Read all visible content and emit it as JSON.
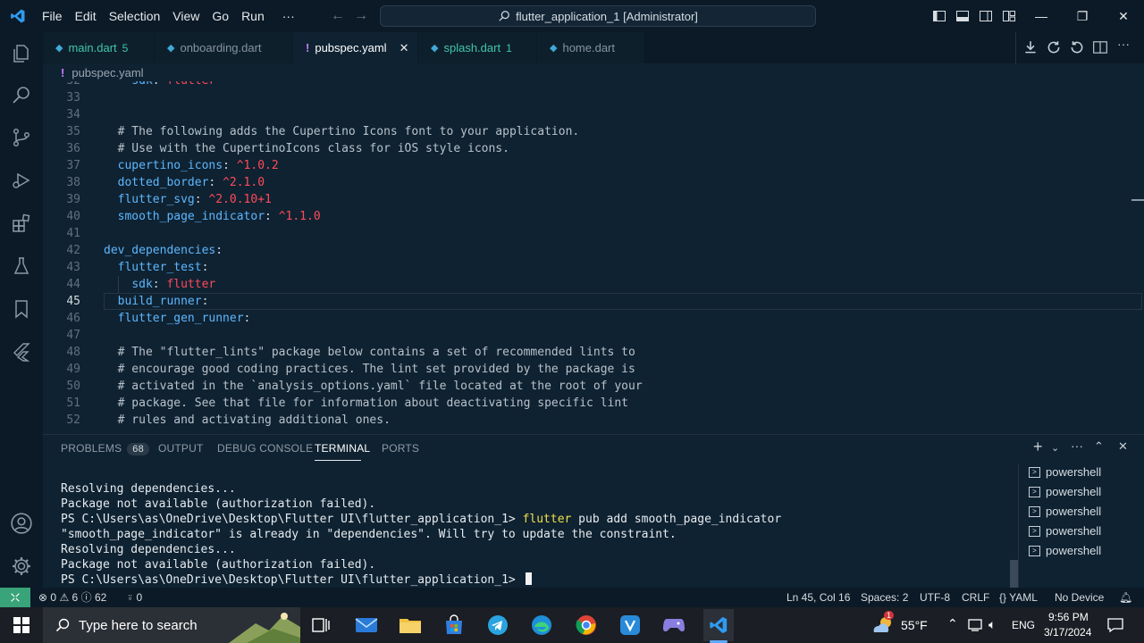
{
  "window": {
    "title": "flutter_application_1 [Administrator]",
    "menu": [
      "File",
      "Edit",
      "Selection",
      "View",
      "Go",
      "Run"
    ],
    "more_menu": "···"
  },
  "tabs": [
    {
      "label": "main.dart",
      "badge": "5",
      "color": "#40c6a8"
    },
    {
      "label": "onboarding.dart",
      "badge": "",
      "color": "#8693a0"
    },
    {
      "label": "pubspec.yaml",
      "badge": "",
      "color": "#ffffff",
      "icon": "!"
    },
    {
      "label": "splash.dart",
      "badge": "1",
      "color": "#40c6a8"
    },
    {
      "label": "home.dart",
      "badge": "",
      "color": "#8693a0"
    }
  ],
  "breadcrumb": {
    "icon": "!",
    "file": "pubspec.yaml"
  },
  "editor": {
    "lines": [
      {
        "n": "32",
        "indent": "    ",
        "parts": [
          {
            "t": "sdk",
            "c": "key"
          },
          {
            "t": ": ",
            "c": "punc"
          },
          {
            "t": "flutter",
            "c": "val"
          }
        ]
      },
      {
        "n": "33",
        "indent": "",
        "parts": []
      },
      {
        "n": "34",
        "indent": "",
        "parts": []
      },
      {
        "n": "35",
        "indent": "  ",
        "parts": [
          {
            "t": "# The following adds the Cupertino Icons font to your application.",
            "c": "comment"
          }
        ]
      },
      {
        "n": "36",
        "indent": "  ",
        "parts": [
          {
            "t": "# Use with the CupertinoIcons class for iOS style icons.",
            "c": "comment"
          }
        ]
      },
      {
        "n": "37",
        "indent": "  ",
        "parts": [
          {
            "t": "cupertino_icons",
            "c": "key"
          },
          {
            "t": ": ",
            "c": "punc"
          },
          {
            "t": "^1.0.2",
            "c": "val"
          }
        ]
      },
      {
        "n": "38",
        "indent": "  ",
        "parts": [
          {
            "t": "dotted_border",
            "c": "key"
          },
          {
            "t": ": ",
            "c": "punc"
          },
          {
            "t": "^2.1.0",
            "c": "val"
          }
        ]
      },
      {
        "n": "39",
        "indent": "  ",
        "parts": [
          {
            "t": "flutter_svg",
            "c": "key"
          },
          {
            "t": ": ",
            "c": "punc"
          },
          {
            "t": "^2.0.10+1",
            "c": "val"
          }
        ]
      },
      {
        "n": "40",
        "indent": "  ",
        "parts": [
          {
            "t": "smooth_page_indicator",
            "c": "key"
          },
          {
            "t": ": ",
            "c": "punc"
          },
          {
            "t": "^1.1.0",
            "c": "val"
          }
        ]
      },
      {
        "n": "41",
        "indent": "",
        "parts": []
      },
      {
        "n": "42",
        "indent": "",
        "parts": [
          {
            "t": "dev_dependencies",
            "c": "key"
          },
          {
            "t": ":",
            "c": "punc"
          }
        ]
      },
      {
        "n": "43",
        "indent": "  ",
        "parts": [
          {
            "t": "flutter_test",
            "c": "key"
          },
          {
            "t": ":",
            "c": "punc"
          }
        ]
      },
      {
        "n": "44",
        "indent": "    ",
        "parts": [
          {
            "t": "sdk",
            "c": "key"
          },
          {
            "t": ": ",
            "c": "punc"
          },
          {
            "t": "flutter",
            "c": "val"
          }
        ]
      },
      {
        "n": "45",
        "indent": "  ",
        "parts": [
          {
            "t": "build_runner",
            "c": "key"
          },
          {
            "t": ":",
            "c": "punc"
          }
        ],
        "current": true
      },
      {
        "n": "46",
        "indent": "  ",
        "parts": [
          {
            "t": "flutter_gen_runner",
            "c": "key"
          },
          {
            "t": ":",
            "c": "punc"
          }
        ]
      },
      {
        "n": "47",
        "indent": "",
        "parts": []
      },
      {
        "n": "48",
        "indent": "  ",
        "parts": [
          {
            "t": "# The \"flutter_lints\" package below contains a set of recommended lints to",
            "c": "comment"
          }
        ]
      },
      {
        "n": "49",
        "indent": "  ",
        "parts": [
          {
            "t": "# encourage good coding practices. The lint set provided by the package is",
            "c": "comment"
          }
        ]
      },
      {
        "n": "50",
        "indent": "  ",
        "parts": [
          {
            "t": "# activated in the `analysis_options.yaml` file located at the root of your",
            "c": "comment"
          }
        ]
      },
      {
        "n": "51",
        "indent": "  ",
        "parts": [
          {
            "t": "# package. See that file for information about deactivating specific lint",
            "c": "comment"
          }
        ]
      },
      {
        "n": "52",
        "indent": "  ",
        "parts": [
          {
            "t": "# rules and activating additional ones.",
            "c": "comment"
          }
        ]
      }
    ]
  },
  "panel": {
    "tabs": {
      "problems": "PROBLEMS",
      "problems_count": "68",
      "output": "OUTPUT",
      "debug": "DEBUG CONSOLE",
      "terminal": "TERMINAL",
      "ports": "PORTS"
    },
    "terminal_lines": [
      {
        "text": "Resolving dependencies..."
      },
      {
        "text": "Package not available (authorization failed)."
      },
      {
        "prompt": "PS C:\\Users\\as\\OneDrive\\Desktop\\Flutter UI\\flutter_application_1> ",
        "cmd": "flutter",
        "rest": " pub add smooth_page_indicator"
      },
      {
        "text": "\"smooth_page_indicator\" is already in \"dependencies\". Will try to update the constraint."
      },
      {
        "text": "Resolving dependencies..."
      },
      {
        "text": "Package not available (authorization failed)."
      },
      {
        "prompt": "PS C:\\Users\\as\\OneDrive\\Desktop\\Flutter UI\\flutter_application_1> ",
        "cmd": "",
        "rest": "",
        "cursor": true
      }
    ],
    "shells": [
      "powershell",
      "powershell",
      "powershell",
      "powershell",
      "powershell"
    ]
  },
  "status": {
    "errors": "0",
    "warnings": "6",
    "info": "62",
    "ports": "0",
    "position": "Ln 45, Col 16",
    "spaces": "Spaces: 2",
    "encoding": "UTF-8",
    "eol": "CRLF",
    "language": "YAML",
    "device": "No Device"
  },
  "taskbar": {
    "search_placeholder": "Type here to search",
    "weather": "55°F",
    "weather_badge": "1",
    "lang": "ENG",
    "time": "9:56 PM",
    "date": "3/17/2024"
  },
  "colors": {
    "accent_terminal_cmd": "#f0e04a",
    "yaml_key": "#5cb7ff",
    "yaml_value": "#ff4a5b",
    "remote_indicator": "#39a37a"
  }
}
